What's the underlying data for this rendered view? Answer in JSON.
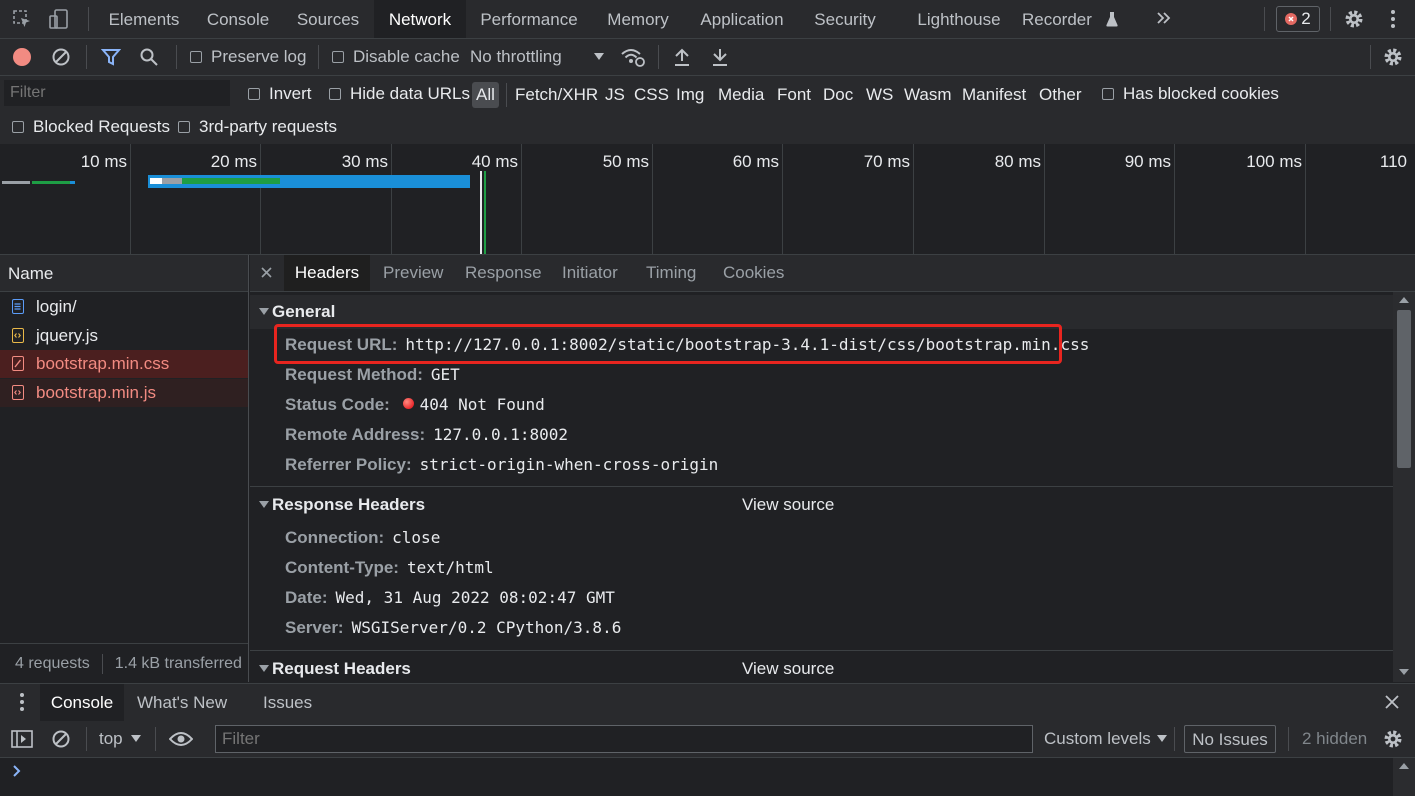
{
  "main_tabs": [
    {
      "label": "Elements"
    },
    {
      "label": "Console"
    },
    {
      "label": "Sources"
    },
    {
      "label": "Network"
    },
    {
      "label": "Performance"
    },
    {
      "label": "Memory"
    },
    {
      "label": "Application"
    },
    {
      "label": "Security"
    },
    {
      "label": "Lighthouse"
    },
    {
      "label": "Recorder"
    }
  ],
  "active_tab": "Network",
  "error_count": "2",
  "toolbar": {
    "preserve_log": "Preserve log",
    "disable_cache": "Disable cache",
    "throttling": "No throttling"
  },
  "filter": {
    "placeholder": "Filter",
    "invert": "Invert",
    "hide_data_urls": "Hide data URLs",
    "types": [
      "All",
      "Fetch/XHR",
      "JS",
      "CSS",
      "Img",
      "Media",
      "Font",
      "Doc",
      "WS",
      "Wasm",
      "Manifest",
      "Other"
    ],
    "has_blocked_cookies": "Has blocked cookies",
    "blocked_requests": "Blocked Requests",
    "third_party": "3rd-party requests"
  },
  "timeline": {
    "ticks": [
      "10 ms",
      "20 ms",
      "30 ms",
      "40 ms",
      "50 ms",
      "60 ms",
      "70 ms",
      "80 ms",
      "90 ms",
      "100 ms",
      "110"
    ]
  },
  "requests": {
    "header": "Name",
    "items": [
      {
        "name": "login/",
        "status": "ok",
        "kind": "doc"
      },
      {
        "name": "jquery.js",
        "status": "ok",
        "kind": "script"
      },
      {
        "name": "bootstrap.min.css",
        "status": "error",
        "kind": "css"
      },
      {
        "name": "bootstrap.min.js",
        "status": "error",
        "kind": "script"
      }
    ],
    "summary_count": "4 requests",
    "summary_transferred": "1.4 kB transferred"
  },
  "detail_tabs": [
    "Headers",
    "Preview",
    "Response",
    "Initiator",
    "Timing",
    "Cookies"
  ],
  "general": {
    "title": "General",
    "request_url_label": "Request URL:",
    "request_url": "http://127.0.0.1:8002/static/bootstrap-3.4.1-dist/css/bootstrap.min.css",
    "request_method_label": "Request Method:",
    "request_method": "GET",
    "status_code_label": "Status Code:",
    "status_code": "404 Not Found",
    "remote_address_label": "Remote Address:",
    "remote_address": "127.0.0.1:8002",
    "referrer_policy_label": "Referrer Policy:",
    "referrer_policy": "strict-origin-when-cross-origin"
  },
  "response_headers": {
    "title": "Response Headers",
    "view_source": "View source",
    "items": [
      {
        "key": "Connection:",
        "value": "close"
      },
      {
        "key": "Content-Type:",
        "value": "text/html"
      },
      {
        "key": "Date:",
        "value": "Wed, 31 Aug 2022 08:02:47 GMT"
      },
      {
        "key": "Server:",
        "value": "WSGIServer/0.2 CPython/3.8.6"
      }
    ]
  },
  "request_headers": {
    "title": "Request Headers",
    "view_source": "View source"
  },
  "drawer": {
    "tabs": [
      "Console",
      "What's New",
      "Issues"
    ],
    "context": "top",
    "filter_placeholder": "Filter",
    "levels": "Custom levels",
    "issues": "No Issues",
    "hidden": "2 hidden"
  },
  "colors": {
    "accent": "#8ab4f8",
    "error": "#f28b82",
    "highlight_box": "#e8251f",
    "timeline_blue": "#1a8fd8",
    "timeline_green": "#1e9e45"
  }
}
